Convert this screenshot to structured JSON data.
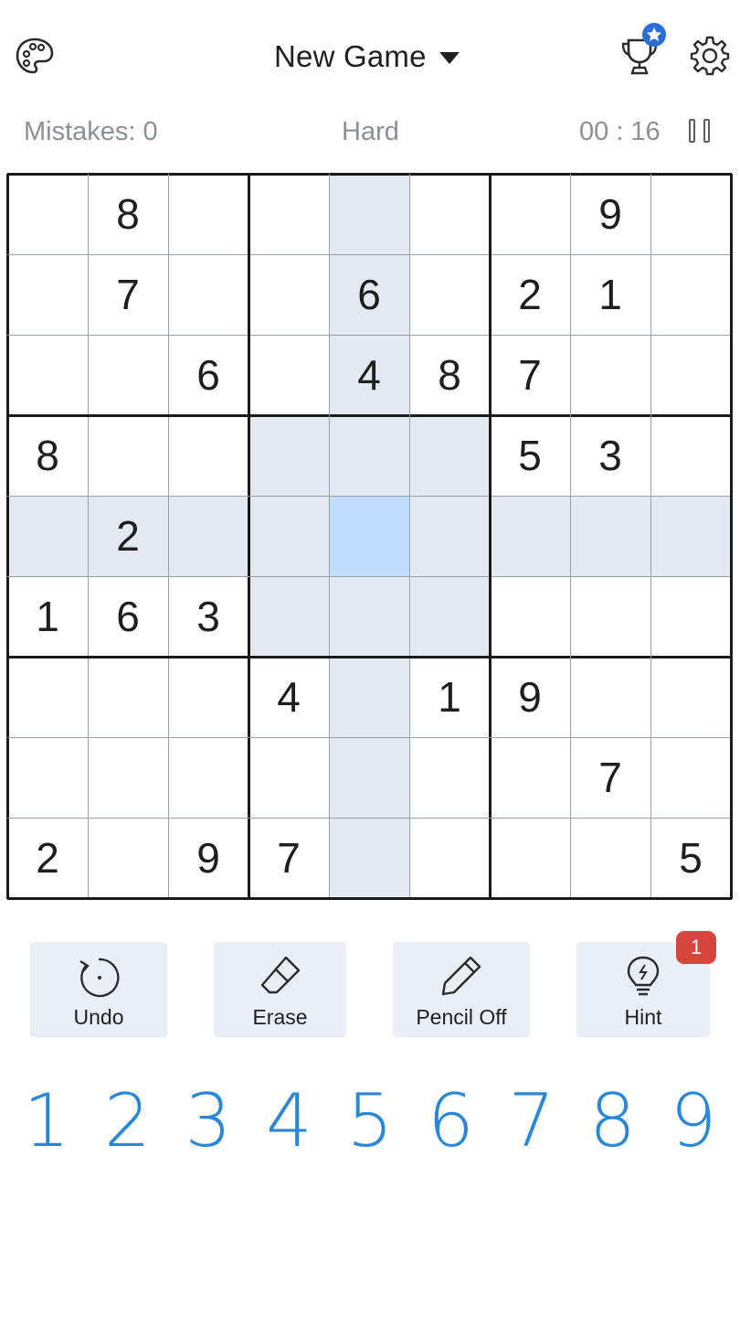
{
  "header": {
    "title": "New Game",
    "icons": [
      "palette-icon",
      "trophy-icon",
      "star-badge-icon",
      "settings-icon",
      "dropdown-caret-icon"
    ]
  },
  "status": {
    "mistakes": "Mistakes: 0",
    "difficulty": "Hard",
    "timer": "00 : 16"
  },
  "board": {
    "selected": {
      "row": 4,
      "col": 4
    },
    "highlight_color": "#e3e8f1",
    "selected_color": "#c2dcfb",
    "grid": [
      [
        "",
        "8",
        "",
        "",
        "",
        "",
        "",
        "9",
        ""
      ],
      [
        "",
        "7",
        "",
        "",
        "6",
        "",
        "2",
        "1",
        ""
      ],
      [
        "",
        "",
        "6",
        "",
        "4",
        "8",
        "7",
        "",
        ""
      ],
      [
        "8",
        "",
        "",
        "",
        "",
        "",
        "5",
        "3",
        ""
      ],
      [
        "",
        "2",
        "",
        "",
        "",
        "",
        "",
        "",
        ""
      ],
      [
        "1",
        "6",
        "3",
        "",
        "",
        "",
        "",
        "",
        ""
      ],
      [
        "",
        "",
        "",
        "4",
        "",
        "1",
        "9",
        "",
        ""
      ],
      [
        "",
        "",
        "",
        "",
        "",
        "",
        "",
        "7",
        ""
      ],
      [
        "2",
        "",
        "9",
        "7",
        "",
        "",
        "",
        "",
        "5"
      ]
    ]
  },
  "tools": {
    "undo": "Undo",
    "erase": "Erase",
    "pencil": "Pencil Off",
    "hint": "Hint",
    "hint_count": "1"
  },
  "numpad": [
    "1",
    "2",
    "3",
    "4",
    "5",
    "6",
    "7",
    "8",
    "9"
  ],
  "colors": {
    "accent": "#2a86d9",
    "badge": "#d8453f",
    "tool_bg": "#eaeef6"
  }
}
